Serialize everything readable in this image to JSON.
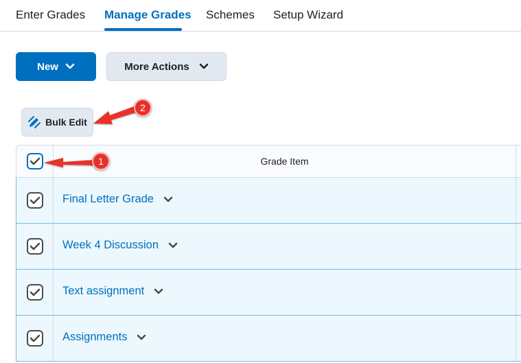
{
  "tabs": [
    {
      "label": "Enter Grades",
      "active": false
    },
    {
      "label": "Manage Grades",
      "active": true
    },
    {
      "label": "Schemes",
      "active": false
    },
    {
      "label": "Setup Wizard",
      "active": false
    }
  ],
  "toolbar": {
    "new_label": "New",
    "more_actions_label": "More Actions"
  },
  "bulk_edit": {
    "label": "Bulk Edit"
  },
  "table": {
    "header": {
      "grade_item": "Grade Item",
      "select_all_checked": true
    },
    "rows": [
      {
        "label": "Final Letter Grade",
        "checked": true
      },
      {
        "label": "Week 4 Discussion",
        "checked": true
      },
      {
        "label": "Text assignment",
        "checked": true
      },
      {
        "label": "Assignments",
        "checked": true
      }
    ]
  },
  "annotations": [
    {
      "number": "1"
    },
    {
      "number": "2"
    }
  ],
  "colors": {
    "accent": "#006fbf",
    "row_selected_bg": "#ecf8fd",
    "annotation_red": "#e8302b"
  }
}
